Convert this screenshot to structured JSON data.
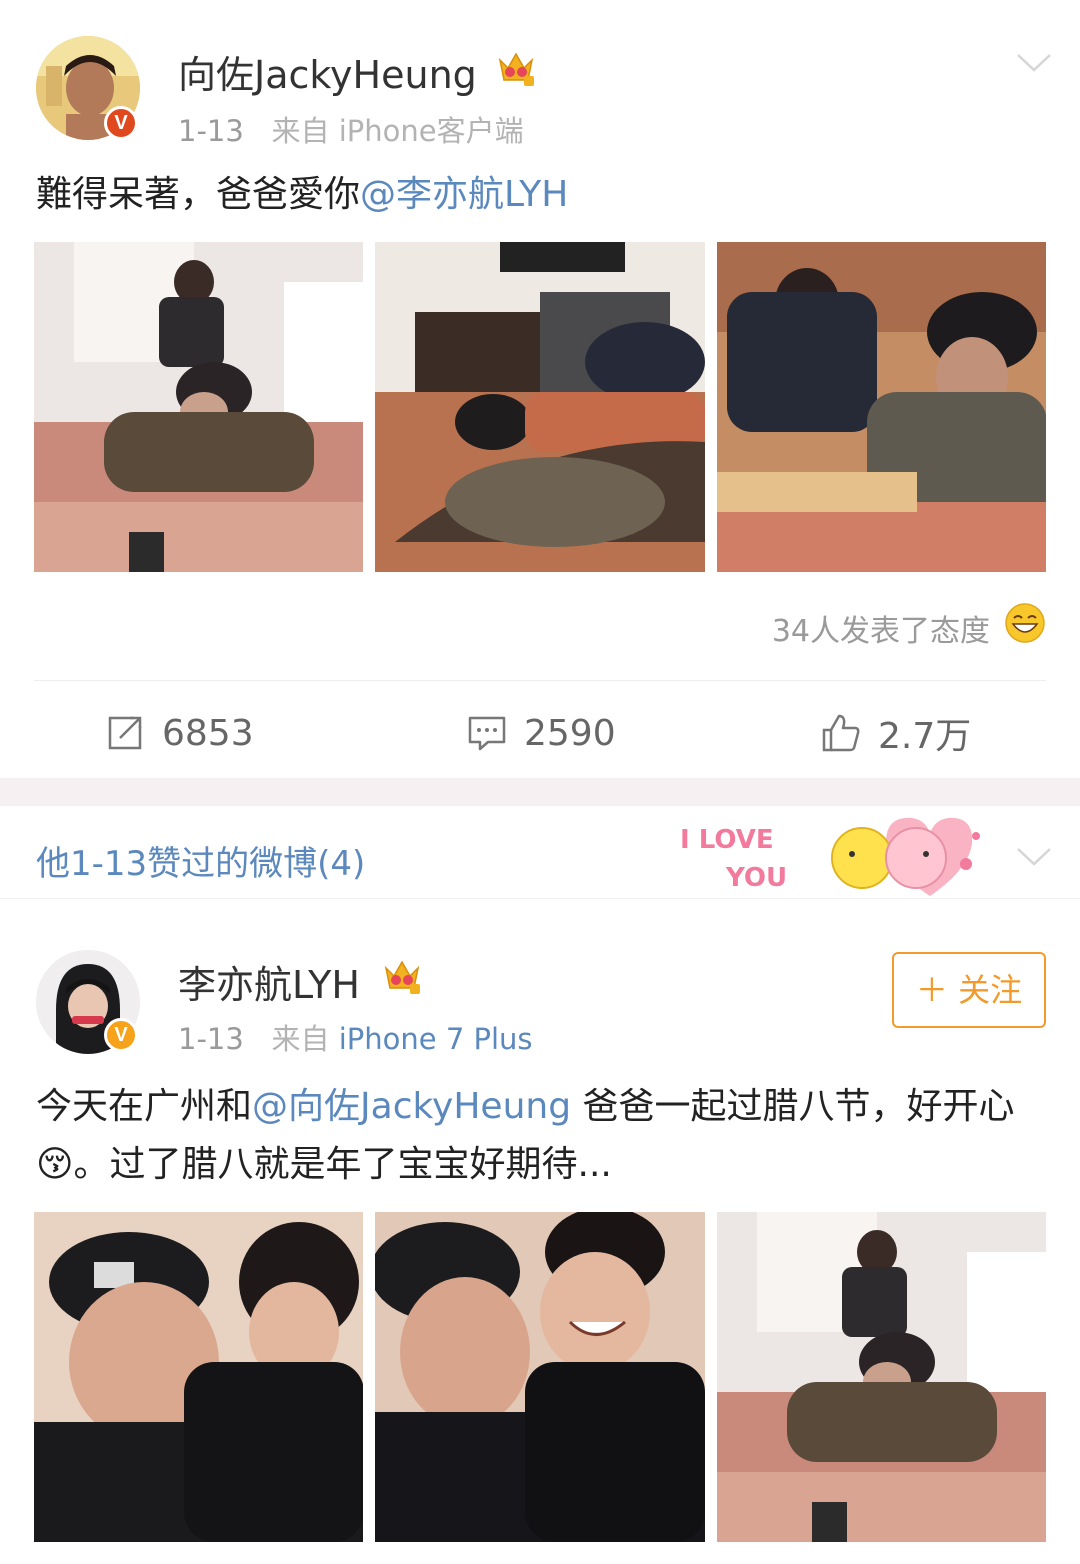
{
  "post1": {
    "username": "向佐JackyHeung",
    "date": "1-13",
    "source_prefix": "来自",
    "source_app": "iPhone客户端",
    "verified_mark": "V",
    "text_before": "難得呆著，爸爸愛你",
    "mention": "@李亦航LYH",
    "attitude_text": "34人发表了态度",
    "repost_count": "6853",
    "comment_count": "2590",
    "like_count": "2.7万"
  },
  "liked_section": {
    "title": "他1-13赞过的微博(4)",
    "sticker_text_1": "I LOVE",
    "sticker_text_2": "YOU"
  },
  "post2": {
    "username": "李亦航LYH",
    "date": "1-13",
    "source_prefix": "来自",
    "source_app": "iPhone 7 Plus",
    "verified_mark": "V",
    "follow_label": "＋ 关注",
    "text_part1": "今天在广州和",
    "mention": "@向佐JackyHeung",
    "text_part2": " 爸爸一起过腊八节，好开心😚。过了腊八就是年了宝宝好期待..."
  },
  "colors": {
    "link_blue": "#5b88bd",
    "follow_orange": "#f29b2c",
    "verified_orange": "#f7a21b"
  }
}
